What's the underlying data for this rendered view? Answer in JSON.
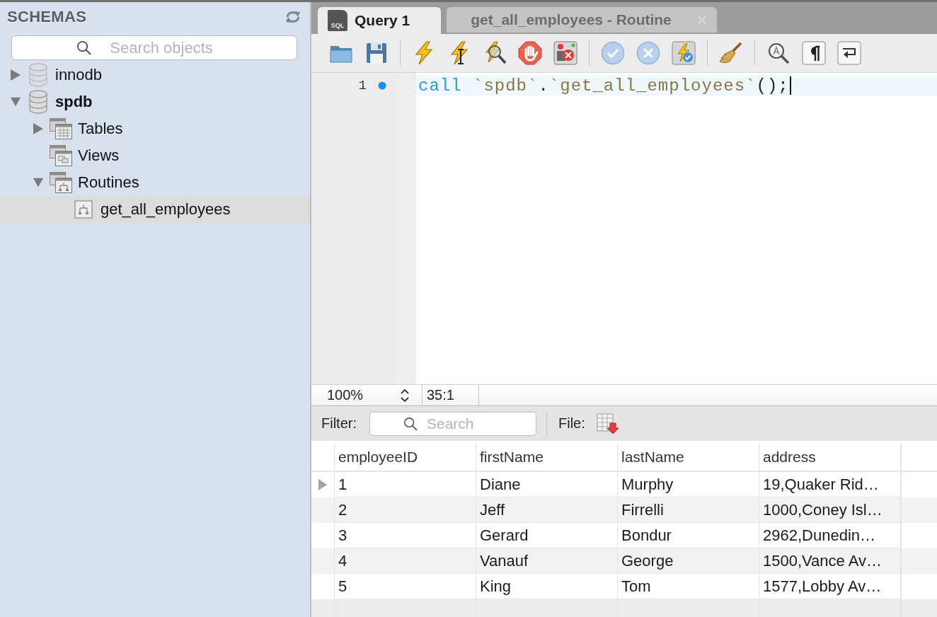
{
  "sidebar": {
    "title": "SCHEMAS",
    "search": {
      "placeholder": "Search objects"
    },
    "tree": [
      {
        "label": "innodb",
        "kind": "schema",
        "expanded": false,
        "default": false,
        "selected": false
      },
      {
        "label": "spdb",
        "kind": "schema",
        "expanded": true,
        "default": true,
        "selected": false,
        "children": [
          {
            "label": "Tables",
            "kind": "table_folder",
            "expanded": false,
            "default": false,
            "selected": false
          },
          {
            "label": "Views",
            "kind": "view_folder",
            "default": false,
            "selected": false
          },
          {
            "label": "Routines",
            "kind": "routine_folder",
            "expanded": true,
            "default": false,
            "selected": false,
            "children": [
              {
                "label": "get_all_employees",
                "kind": "routine",
                "default": false,
                "selected": true
              }
            ]
          }
        ]
      }
    ]
  },
  "tabs": [
    {
      "label": "Query 1",
      "badge": "SQL",
      "selected": true,
      "closable": false
    },
    {
      "label": "get_all_employees - Routine",
      "selected": false,
      "closable": true
    }
  ],
  "editor": {
    "lines": [
      {
        "number": "1",
        "current": true,
        "marker": true,
        "tokens": [
          {
            "text": "call",
            "kind": "keyword"
          },
          {
            "text": " `spdb`",
            "kind": "identifier"
          },
          {
            "text": ".",
            "kind": "plain"
          },
          {
            "text": "`get_all_employees`",
            "kind": "identifier"
          },
          {
            "text": "();",
            "kind": "plain"
          }
        ]
      }
    ]
  },
  "status_bar": {
    "zoom": "100%",
    "position": "35:1"
  },
  "result_toolbar": {
    "filter_label": "Filter:",
    "search": {
      "placeholder": "Search"
    },
    "file_label": "File:"
  },
  "result_grid": {
    "columns": [
      "employeeID",
      "firstName",
      "lastName",
      "address"
    ],
    "rows": [
      {
        "current": true,
        "cells": [
          "1",
          "Diane",
          "Murphy",
          "19,Quaker Rid…"
        ]
      },
      {
        "current": false,
        "cells": [
          "2",
          "Jeff",
          "Firrelli",
          "1000,Coney Isl…"
        ]
      },
      {
        "current": false,
        "cells": [
          "3",
          "Gerard",
          "Bondur",
          "2962,Dunedin…"
        ]
      },
      {
        "current": false,
        "cells": [
          "4",
          "Vanauf",
          "George",
          "1500,Vance Av…"
        ]
      },
      {
        "current": false,
        "cells": [
          "5",
          "King",
          "Tom",
          "1577,Lobby Av…"
        ]
      }
    ]
  }
}
